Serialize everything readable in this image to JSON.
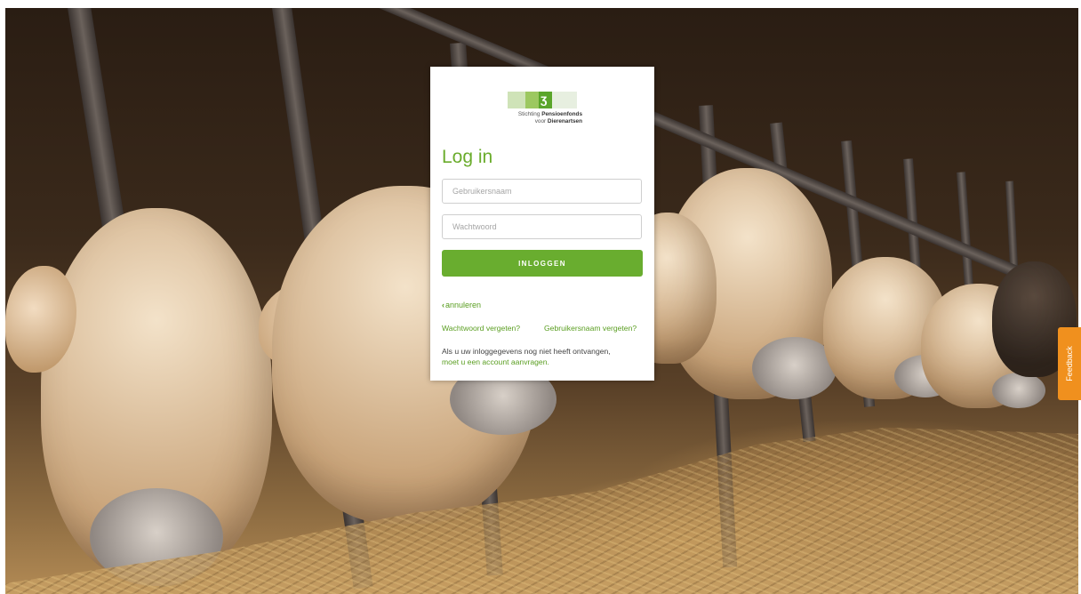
{
  "logo": {
    "line1_prefix": "Stichting",
    "line1_bold": "Pensioenfonds",
    "line2_prefix": "voor",
    "line2_bold": "Dierenartsen",
    "mark": "ʒ"
  },
  "login": {
    "title": "Log in",
    "username_placeholder": "Gebruikersnaam",
    "password_placeholder": "Wachtwoord",
    "submit_label": "INLOGGEN",
    "cancel_label": "annuleren",
    "forgot_password": "Wachtwoord vergeten?",
    "forgot_username": "Gebruikersnaam vergeten?",
    "info_text": "Als u uw inloggegevens nog niet heeft ontvangen,",
    "info_link": "moet u een account aanvragen."
  },
  "feedback": {
    "label": "Feedback"
  },
  "colors": {
    "accent_green": "#69ad2f",
    "link_green": "#5a9e21",
    "feedback_orange": "#f0901e"
  },
  "icons": {
    "cancel": "chevron-left-icon"
  }
}
